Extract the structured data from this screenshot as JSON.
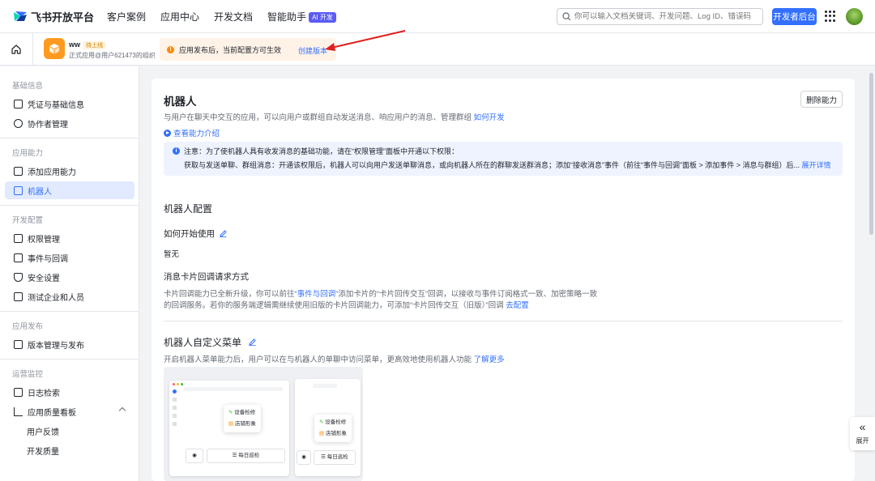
{
  "brand": {
    "name": "飞书开放平台"
  },
  "nav": {
    "items": [
      "客户案例",
      "应用中心",
      "开发文档",
      "智能助手"
    ],
    "ai_badge": "AI 开发"
  },
  "search": {
    "placeholder": "你可以输入文档关键词、开发问题、Log ID、错误码"
  },
  "dev_console": "开发者后台",
  "app": {
    "name": "ww",
    "status": "待上线",
    "org": "正式应用@用户621473的组织"
  },
  "notice": {
    "text": "应用发布后，当前配置方可生效",
    "link": "创建版本"
  },
  "sidebar": {
    "groups": [
      "基础信息",
      "应用能力",
      "开发配置",
      "应用发布",
      "运营监控"
    ],
    "items": [
      "凭证与基础信息",
      "协作者管理",
      "添加应用能力",
      "机器人",
      "权限管理",
      "事件与回调",
      "安全设置",
      "测试企业和人员",
      "版本管理与发布",
      "日志检索",
      "应用质量看板",
      "用户反馈",
      "开发质量"
    ]
  },
  "main": {
    "title": "机器人",
    "desc": "与用户在聊天中交互的应用，可以向用户或群组自动发送消息、响应用户的消息、管理群组",
    "desc_link": "如何开发",
    "intro_link": "查看能力介绍",
    "delete_button": "删除能力",
    "info": {
      "line1": "注意：为了使机器人具有收发消息的基础功能，请在“权限管理”面板中开通以下权限：",
      "line2": "获取与发送单聊、群组消息：开通该权限后，机器人可以向用户发送单聊消息，或向机器人所在的群聊发送群消息；添加“接收消息”事件（前往“事件与回调”面板 > 添加事件 > 消息与群组）后...",
      "link": "展开详情"
    },
    "config_title": "机器人配置",
    "howto_title": "如何开始使用",
    "howto_value": "暂无",
    "card_title": "消息卡片回调请求方式",
    "card_l1_a": "卡片回调能力已全新升级，你可以前往",
    "card_l1_link": "“事件与回调”",
    "card_l1_b": "添加卡片的“卡片回传交互”回调，以接收与事件订阅格式一致、加密策略一致",
    "card_l2_a": "的回调服务。若你的服务端逻辑需继续使用旧版的卡片回调能力，可添加“卡片回传交互（旧版）”回调",
    "card_l2_link": "去配置",
    "menu_title": "机器人自定义菜单",
    "menu_desc": "开启机器人菜单能力后，用户可以在与机器人的单聊中访问菜单，更高效地使用机器人功能",
    "menu_link": "了解更多",
    "preview": {
      "item1": "设备检修",
      "item2": "店铺形象",
      "bar": "☰ 每日巡检"
    }
  },
  "expand": {
    "label": "展开"
  },
  "colors": {
    "accent": "#3370ff",
    "warning": "#ff8800",
    "active_bg": "#e1eaff"
  }
}
